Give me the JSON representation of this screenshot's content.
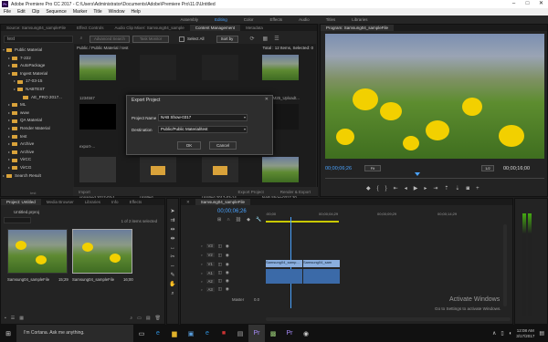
{
  "titlebar": {
    "logo": "Pr",
    "title": "Adobe Premiere Pro CC 2017 - C:\\Users\\Administrator\\Documents\\Adobe\\Premiere Pro\\11.0\\Untitled",
    "min": "–",
    "max": "□",
    "close": "✕"
  },
  "menu": [
    "File",
    "Edit",
    "Clip",
    "Sequence",
    "Marker",
    "Title",
    "Window",
    "Help"
  ],
  "workspaces": [
    "Assembly",
    "Editing",
    "Color",
    "Effects",
    "Audio",
    "Titles",
    "Libraries"
  ],
  "workspaces_active": "Editing",
  "source_tabs": [
    "Source: Samsung04_sampleFile",
    "Effect Controls",
    "Audio Clip Mixer: Samsung04_sample",
    "Content Management",
    "Metadata"
  ],
  "cm": {
    "search_placeholder": "test",
    "advanced_search": "Advanced Search",
    "task_monitor": "Task Monitor",
    "select_all": "Select All",
    "sort_by": "Sort by",
    "path": "Public / Public Material / test",
    "total": "Total : 12 Items, Selected: 0",
    "tree": [
      {
        "label": "Public Material",
        "indent": 0,
        "arrow": "▾"
      },
      {
        "label": "7-222",
        "indent": 1,
        "arrow": "▸"
      },
      {
        "label": "AutoPackage",
        "indent": 1,
        "arrow": "▸"
      },
      {
        "label": "Ingest Material",
        "indent": 1,
        "arrow": "▾"
      },
      {
        "label": "17-03-15",
        "indent": 2,
        "arrow": "▸"
      },
      {
        "label": "NABTEST",
        "indent": 2,
        "arrow": "▸"
      },
      {
        "label": "AE_PRO 2017...",
        "indent": 3,
        "arrow": ""
      },
      {
        "label": "ML",
        "indent": 1,
        "arrow": "▸"
      },
      {
        "label": "www",
        "indent": 1,
        "arrow": "▸"
      },
      {
        "label": "QA Material",
        "indent": 1,
        "arrow": "▸"
      },
      {
        "label": "Render Material",
        "indent": 1,
        "arrow": "▸"
      },
      {
        "label": "test",
        "indent": 1,
        "arrow": "▸"
      },
      {
        "label": "Archive",
        "indent": 1,
        "arrow": "▸"
      },
      {
        "label": "Archive",
        "indent": 1,
        "arrow": "▸"
      },
      {
        "label": "VirCC",
        "indent": 1,
        "arrow": "▸"
      },
      {
        "label": "VirCG",
        "indent": 1,
        "arrow": "▸"
      },
      {
        "label": "Search Result",
        "indent": 0,
        "arrow": "▸"
      }
    ],
    "bottom_item": "test",
    "items_row1": [
      "1234567",
      "RETEST",
      "autoPackage-template",
      "SVCAM25_Uploadt..."
    ],
    "items_row2": [
      "export-...",
      "",
      "",
      ""
    ],
    "items_row3": [
      "unnamed 2017-03-1...",
      "Untitled",
      "Untitled 2017-03-14",
      "NAB Show-0317 20..."
    ],
    "import": "Import",
    "export_project": "Export Project",
    "render_export": "Render & Export"
  },
  "dialog": {
    "title": "Export Project",
    "project_name_label": "Project Name",
    "project_name_value": "NAB Show-0317",
    "destination_label": "Destination",
    "destination_value": "Public/Public Material/test",
    "ok": "OK",
    "cancel": "Cancel"
  },
  "program": {
    "tab": "Program: Samsung04_sampleFile",
    "timecode": "00;00;06;26",
    "fit": "Fit",
    "ratio": "1/2",
    "duration": "00;00;16;00"
  },
  "project": {
    "tabs": [
      "Project: Untitled",
      "Media Browser",
      "Libraries",
      "Info",
      "Effects"
    ],
    "file": "Untitled.prproj",
    "selection": "1 of 2 items selected",
    "clips": [
      {
        "name": "Samsung04_sampleFile",
        "duration": "15;29"
      },
      {
        "name": "Samsung04_sampleFile",
        "duration": "16;00"
      }
    ]
  },
  "timeline": {
    "tab": "Samsung04_sampleFile",
    "timecode": "00;00;06;26",
    "ruler": [
      ":00;00",
      "00;00;04;29",
      "00;00;09;29",
      "00;00;14;29"
    ],
    "tracks_video": [
      "V3",
      "V2",
      "V1"
    ],
    "tracks_audio": [
      "A1",
      "A2",
      "A3"
    ],
    "clip1": "Samsung04_samp...",
    "clip2": "Samsung04_sam",
    "master": "0.0"
  },
  "watermark": {
    "line1": "Activate Windows",
    "line2": "Go to Settings to activate Windows."
  },
  "taskbar": {
    "search": "I'm Cortana. Ask me anything.",
    "time": "12:08 AM",
    "date": "3/17/2017"
  }
}
